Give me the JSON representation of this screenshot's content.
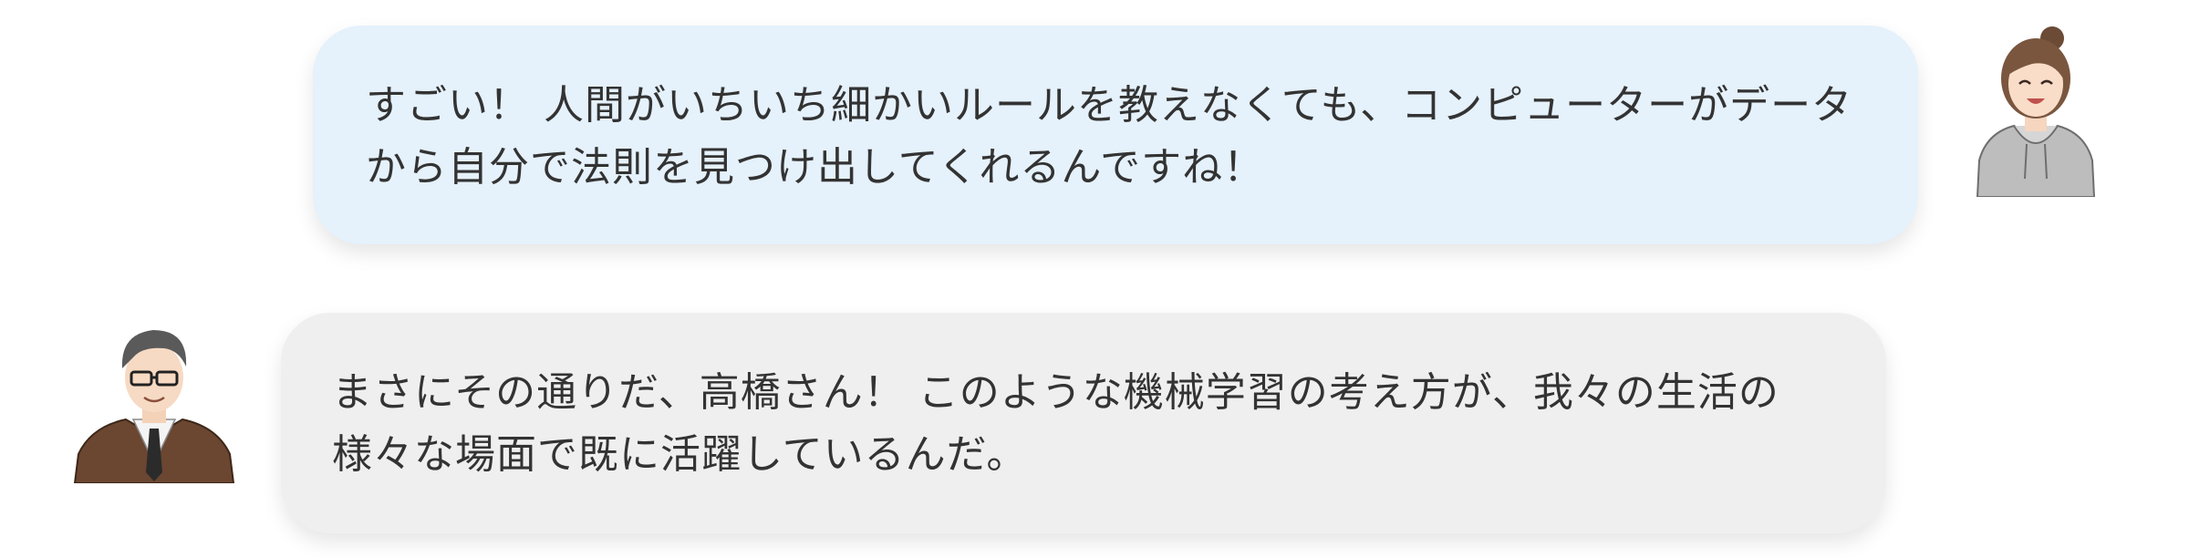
{
  "messages": [
    {
      "speaker": "student",
      "text": "すごい！ 人間がいちいち細かいルールを教えなくても、コンピューターがデータから自分で法則を見つけ出してくれるんですね！",
      "bubble_color": "#e5f1fb"
    },
    {
      "speaker": "teacher",
      "text": "まさにその通りだ、高橋さん！ このような機械学習の考え方が、我々の生活の様々な場面で既に活躍しているんだ。",
      "bubble_color": "#efefef"
    }
  ],
  "icons": {
    "student": "girl-avatar-icon",
    "teacher": "teacher-avatar-icon"
  }
}
